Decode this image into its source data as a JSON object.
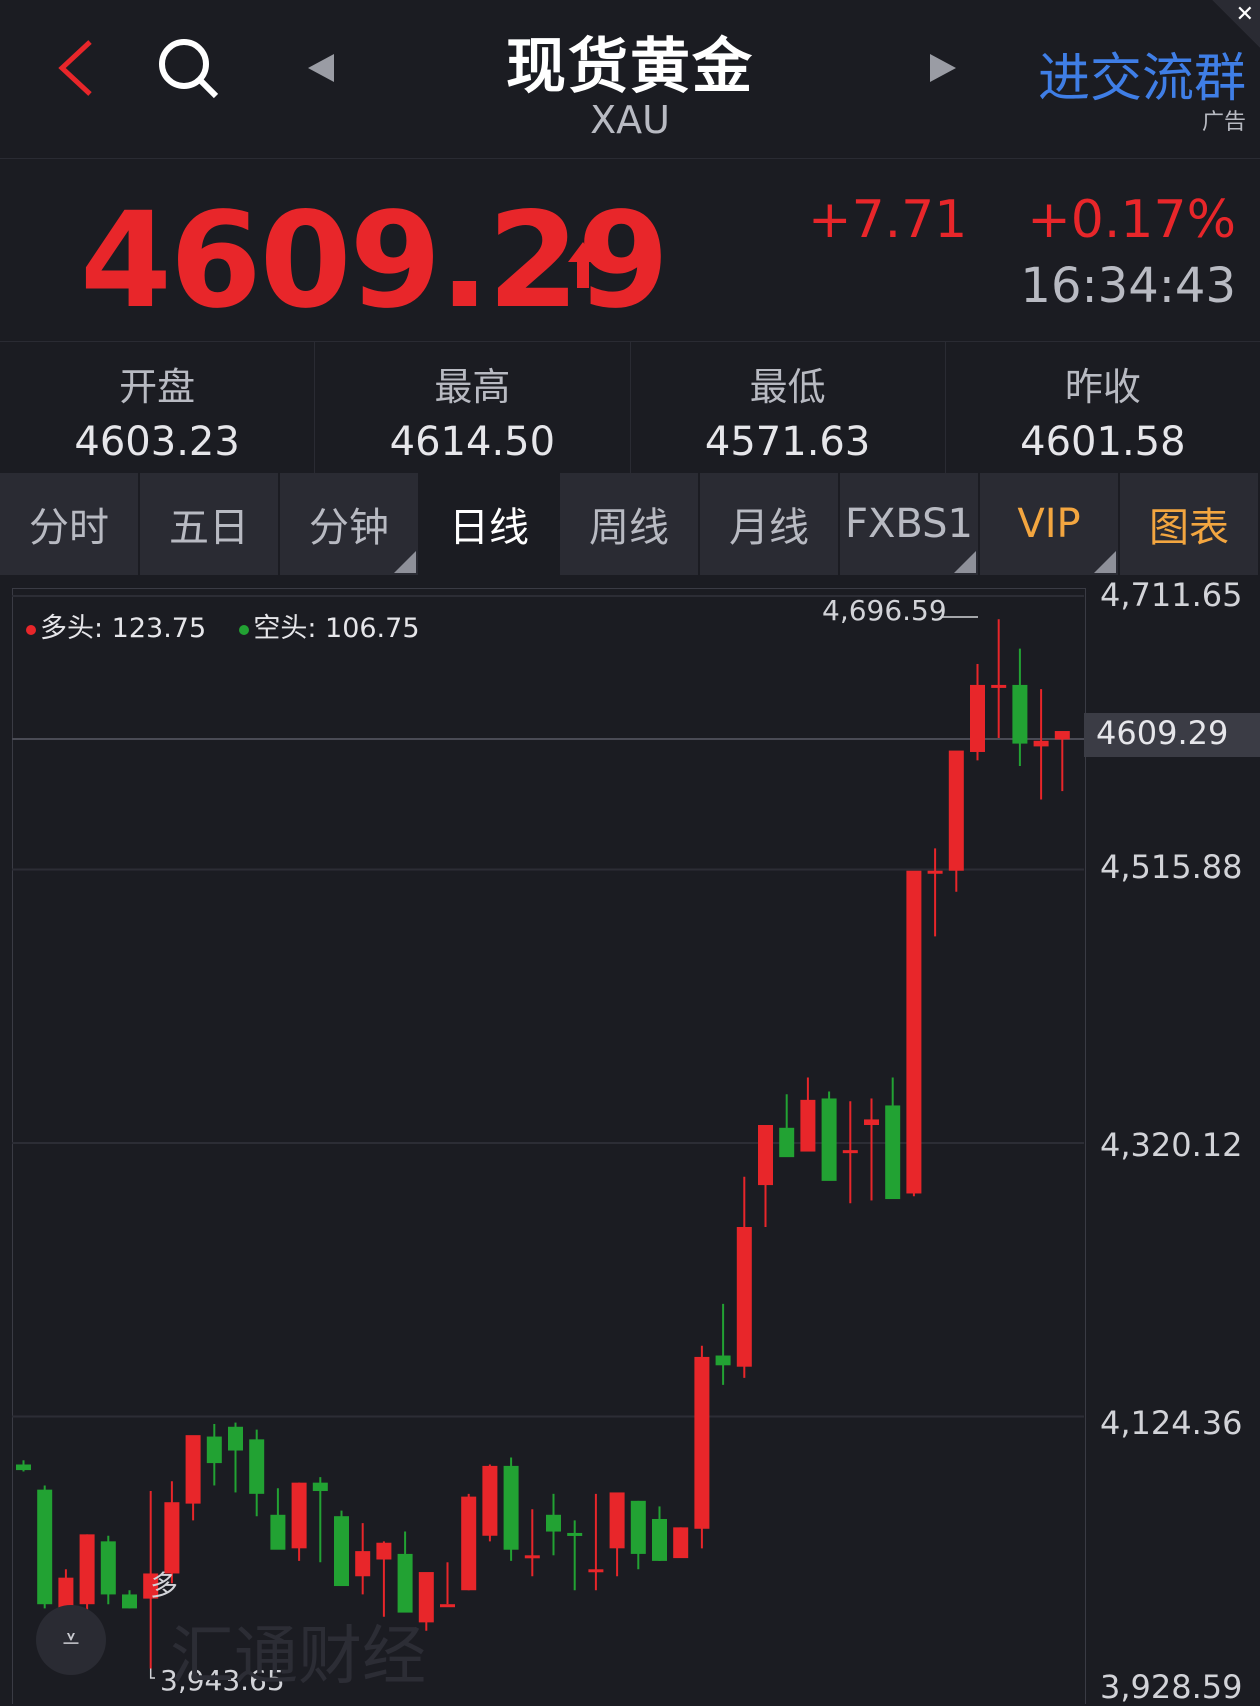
{
  "header": {
    "title": "现货黄金",
    "symbol": "XAU",
    "join_label": "进交流群",
    "ad_label": "广告"
  },
  "quote": {
    "price": "4609.29",
    "change": "+7.71",
    "change_pct": "+0.17%",
    "time": "16:34:43"
  },
  "stats": [
    {
      "label": "开盘",
      "value": "4603.23"
    },
    {
      "label": "最高",
      "value": "4614.50"
    },
    {
      "label": "最低",
      "value": "4571.63"
    },
    {
      "label": "昨收",
      "value": "4601.58"
    }
  ],
  "tabs": [
    "分时",
    "五日",
    "分钟",
    "日线",
    "周线",
    "月线",
    "FXBS1",
    "VIP",
    "图表"
  ],
  "active_tab": "日线",
  "legend": {
    "long_label": "多头: 123.75",
    "short_label": "空头: 106.75"
  },
  "watermark": "汇通财经",
  "colors": {
    "up": "#e8262a",
    "down": "#22a233",
    "link": "#3f7ee6",
    "vip": "#f3a640"
  },
  "chart_data": {
    "type": "candlestick",
    "y_ticks": [
      "4,711.65",
      "4,515.88",
      "4,320.12",
      "4,124.36",
      "3,928.59"
    ],
    "ylim": [
      3928.59,
      4711.65
    ],
    "current_label": "4609.29",
    "high_label": "4,696.59",
    "low_label": "3,943.65",
    "marker_label": "多",
    "candles": [
      {
        "o": 4086,
        "h": 4093,
        "l": 4085,
        "c": 4090,
        "d": false
      },
      {
        "o": 4072,
        "h": 4075,
        "l": 3987,
        "c": 3990,
        "d": false
      },
      {
        "o": 3987,
        "h": 4015,
        "l": 3978,
        "c": 4009,
        "d": true
      },
      {
        "o": 3990,
        "h": 4040,
        "l": 3983,
        "c": 4040,
        "d": true
      },
      {
        "o": 4035,
        "h": 4039,
        "l": 3990,
        "c": 3997,
        "d": false
      },
      {
        "o": 3997,
        "h": 4000,
        "l": 3987,
        "c": 3987,
        "d": false
      },
      {
        "o": 3994,
        "h": 4071,
        "l": 3944,
        "c": 4012,
        "d": true
      },
      {
        "o": 4012,
        "h": 4078,
        "l": 4005,
        "c": 4063,
        "d": true
      },
      {
        "o": 4062,
        "h": 4110,
        "l": 4050,
        "c": 4111,
        "d": true
      },
      {
        "o": 4110,
        "h": 4119,
        "l": 4075,
        "c": 4091,
        "d": false
      },
      {
        "o": 4100,
        "h": 4120,
        "l": 4070,
        "c": 4117,
        "d": false
      },
      {
        "o": 4108,
        "h": 4115,
        "l": 4053,
        "c": 4069,
        "d": false
      },
      {
        "o": 4054,
        "h": 4073,
        "l": 4030,
        "c": 4029,
        "d": false
      },
      {
        "o": 4030,
        "h": 4077,
        "l": 4021,
        "c": 4077,
        "d": true
      },
      {
        "o": 4077,
        "h": 4081,
        "l": 4020,
        "c": 4071,
        "d": false
      },
      {
        "o": 4053,
        "h": 4057,
        "l": 4003,
        "c": 4003,
        "d": false
      },
      {
        "o": 4010,
        "h": 4048,
        "l": 3997,
        "c": 4028,
        "d": true
      },
      {
        "o": 4022,
        "h": 4035,
        "l": 3981,
        "c": 4034,
        "d": true
      },
      {
        "o": 4026,
        "h": 4042,
        "l": 3985,
        "c": 3984,
        "d": false
      },
      {
        "o": 3977,
        "h": 4000,
        "l": 3971,
        "c": 4013,
        "d": true
      },
      {
        "o": 3990,
        "h": 4020,
        "l": 3990,
        "c": 3990,
        "d": true
      },
      {
        "o": 4000,
        "h": 4069,
        "l": 4000,
        "c": 4067,
        "d": true
      },
      {
        "o": 4039,
        "h": 4090,
        "l": 4035,
        "c": 4089,
        "d": true
      },
      {
        "o": 4089,
        "h": 4095,
        "l": 4021,
        "c": 4029,
        "d": false
      },
      {
        "o": 4025,
        "h": 4058,
        "l": 4010,
        "c": 4025,
        "d": true
      },
      {
        "o": 4054,
        "h": 4069,
        "l": 4025,
        "c": 4042,
        "d": false
      },
      {
        "o": 4041,
        "h": 4050,
        "l": 4000,
        "c": 4041,
        "d": false
      },
      {
        "o": 4015,
        "h": 4069,
        "l": 4000,
        "c": 4015,
        "d": true
      },
      {
        "o": 4030,
        "h": 4060,
        "l": 4010,
        "c": 4070,
        "d": true
      },
      {
        "o": 4064,
        "h": 4064,
        "l": 4015,
        "c": 4026,
        "d": false
      },
      {
        "o": 4051,
        "h": 4060,
        "l": 4021,
        "c": 4021,
        "d": false
      },
      {
        "o": 4023,
        "h": 4045,
        "l": 4026,
        "c": 4045,
        "d": true
      },
      {
        "o": 4044,
        "h": 4175,
        "l": 4030,
        "c": 4167,
        "d": true
      },
      {
        "o": 4168,
        "h": 4205,
        "l": 4147,
        "c": 4161,
        "d": false
      },
      {
        "o": 4160,
        "h": 4296,
        "l": 4152,
        "c": 4260,
        "d": true
      },
      {
        "o": 4290,
        "h": 4328,
        "l": 4260,
        "c": 4333,
        "d": true
      },
      {
        "o": 4331,
        "h": 4355,
        "l": 4313,
        "c": 4310,
        "d": false
      },
      {
        "o": 4314,
        "h": 4367,
        "l": 4315,
        "c": 4351,
        "d": true
      },
      {
        "o": 4352,
        "h": 4357,
        "l": 4298,
        "c": 4293,
        "d": false
      },
      {
        "o": 4314,
        "h": 4350,
        "l": 4277,
        "c": 4315,
        "d": true
      },
      {
        "o": 4337,
        "h": 4352,
        "l": 4279,
        "c": 4333,
        "d": true
      },
      {
        "o": 4347,
        "h": 4367,
        "l": 4280,
        "c": 4280,
        "d": false
      },
      {
        "o": 4284,
        "h": 4288,
        "l": 4282,
        "c": 4515,
        "d": true
      },
      {
        "o": 4514,
        "h": 4531,
        "l": 4468,
        "c": 4515,
        "d": true
      },
      {
        "o": 4515,
        "h": 4591,
        "l": 4500,
        "c": 4601,
        "d": true
      },
      {
        "o": 4600,
        "h": 4663,
        "l": 4594,
        "c": 4648,
        "d": true
      },
      {
        "o": 4648,
        "h": 4695,
        "l": 4610,
        "c": 4648,
        "d": true
      },
      {
        "o": 4648,
        "h": 4674,
        "l": 4590,
        "c": 4606,
        "d": false
      },
      {
        "o": 4604,
        "h": 4645,
        "l": 4566,
        "c": 4608,
        "d": true
      },
      {
        "o": 4609,
        "h": 4612,
        "l": 4572,
        "c": 4615,
        "d": true
      }
    ]
  }
}
